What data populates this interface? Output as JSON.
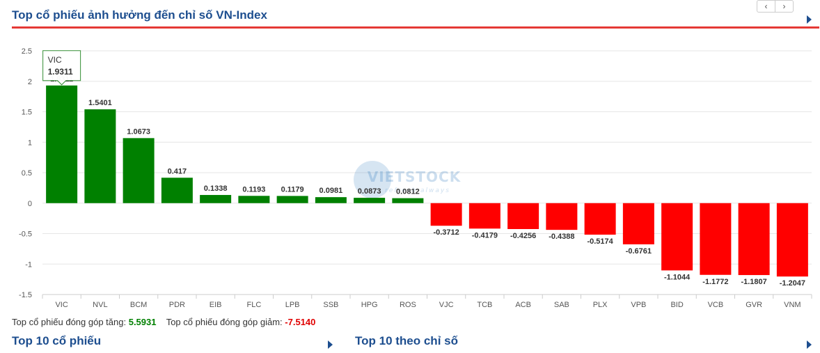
{
  "header": {
    "title": "Top cổ phiếu ảnh hưởng đến chỉ số VN-Index",
    "prev_icon": "chevron-left-icon",
    "next_icon": "chevron-right-icon"
  },
  "colors": {
    "accent": "#1d4e8f",
    "rule": "#e53935",
    "positive": "#008000",
    "negative": "#ff0000"
  },
  "chart_data": {
    "type": "bar",
    "title": "",
    "xlabel": "",
    "ylabel": "",
    "ylim": [
      -1.5,
      2.5
    ],
    "yticks": [
      "2.5",
      "2",
      "1.5",
      "1",
      "0.5",
      "0",
      "-0.5",
      "-1",
      "-1.5"
    ],
    "grid": true,
    "categories": [
      "VIC",
      "NVL",
      "BCM",
      "PDR",
      "EIB",
      "FLC",
      "LPB",
      "SSB",
      "HPG",
      "ROS",
      "VJC",
      "TCB",
      "ACB",
      "SAB",
      "PLX",
      "VPB",
      "BID",
      "VCB",
      "GVR",
      "VNM"
    ],
    "values": [
      1.9311,
      1.5401,
      1.0673,
      0.417,
      0.1338,
      0.1193,
      0.1179,
      0.0981,
      0.0873,
      0.0812,
      -0.3712,
      -0.4179,
      -0.4256,
      -0.4388,
      -0.5174,
      -0.6761,
      -1.1044,
      -1.1772,
      -1.1807,
      -1.2047
    ],
    "labels": [
      "1.9311",
      "1.5401",
      "1.0673",
      "0.417",
      "0.1338",
      "0.1193",
      "0.1179",
      "0.0981",
      "0.0873",
      "0.0812",
      "-0.3712",
      "-0.4179",
      "-0.4256",
      "-0.4388",
      "-0.5174",
      "-0.6761",
      "-1.1044",
      "-1.1772",
      "-1.1807",
      "-1.2047"
    ],
    "tooltip": {
      "category": "VIC",
      "value": "1.9311"
    },
    "watermark": {
      "brand": "VIETSTOCK",
      "tagline": "refresh always"
    }
  },
  "summary": {
    "gain_label": "Top cổ phiếu đóng góp tăng:",
    "gain_value": "5.5931",
    "loss_label": "Top cổ phiếu đóng góp giảm:",
    "loss_value": "-7.5140"
  },
  "bottom": {
    "left_heading": "Top 10 cổ phiếu",
    "right_heading": "Top 10 theo chỉ số"
  }
}
